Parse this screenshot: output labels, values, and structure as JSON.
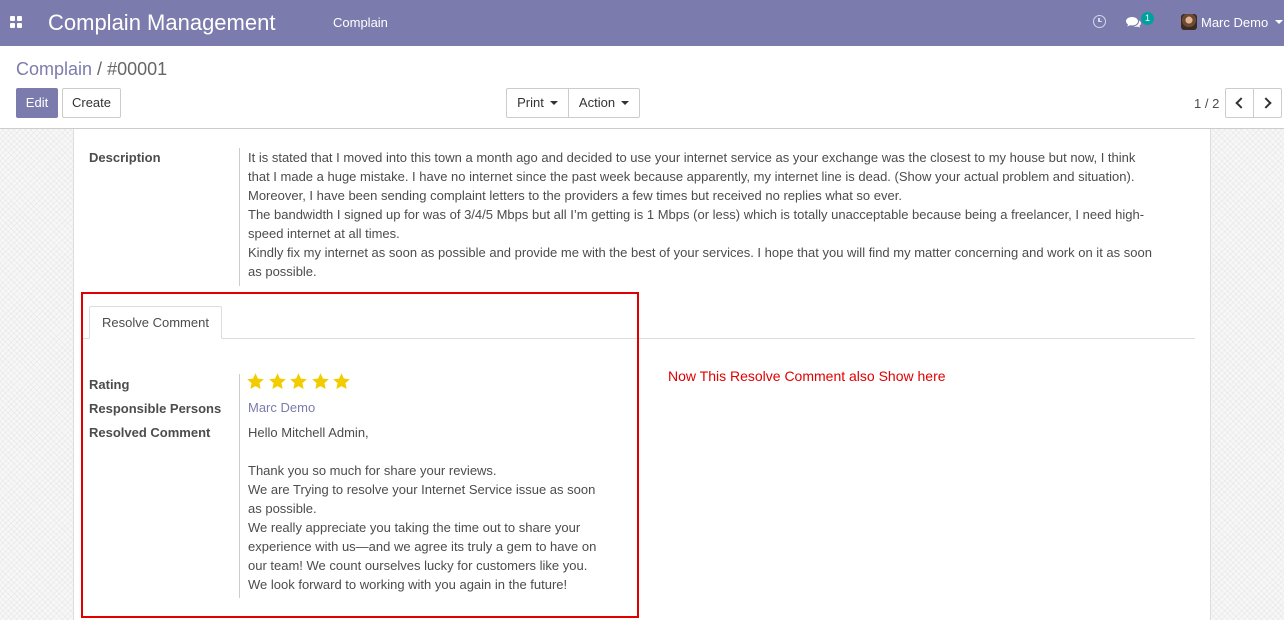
{
  "navbar": {
    "app_title": "Complain Management",
    "menu_items": [
      "Complain"
    ],
    "chat_count": "1",
    "user_name": "Marc Demo",
    "color": "#7c7bad"
  },
  "control_panel": {
    "breadcrumb_parent": "Complain",
    "breadcrumb_separator": "/",
    "breadcrumb_current": "#00001",
    "edit_label": "Edit",
    "create_label": "Create",
    "print_label": "Print",
    "action_label": "Action",
    "pager": "1 / 2"
  },
  "form": {
    "description_label": "Description",
    "description_lines": [
      "It is stated that I moved into this town a month ago and decided to use your internet service as your exchange was the closest to my house but now, I think that I made a huge mistake. I have no internet since the past week because apparently, my internet line is dead. (Show your actual problem and situation).",
      "Moreover, I have been sending complaint letters to the providers a few times but received no replies what so ever.",
      "The bandwidth I signed up for was of 3/4/5 Mbps but all I’m getting is 1 Mbps (or less) which is totally unacceptable because being a freelancer, I need high-speed internet at all times.",
      "Kindly fix my internet as soon as possible and provide me with the best of your services. I hope that you will find my matter concerning and work on it as soon as possible."
    ],
    "tab_label": "Resolve Comment",
    "rating_label": "Rating",
    "rating_value": 5,
    "rating_max": 5,
    "star_color": "#f3cc00",
    "responsible_label": "Responsible Persons",
    "responsible_value": "Marc Demo",
    "resolved_comment_label": "Resolved Comment",
    "resolved_comment_lines": [
      "Hello  Mitchell Admin,",
      "",
      "Thank you so much for share your reviews.",
      "We are Trying to resolve your Internet Service issue as soon as possible.",
      "We really appreciate you taking the time out to share your experience with us—and we agree its truly a gem to have on our team! We count ourselves lucky for customers like you.",
      "We look forward to working with you again in the future!"
    ]
  },
  "annotation": {
    "note": "Now This Resolve Comment also Show here",
    "color": "#e00000"
  }
}
